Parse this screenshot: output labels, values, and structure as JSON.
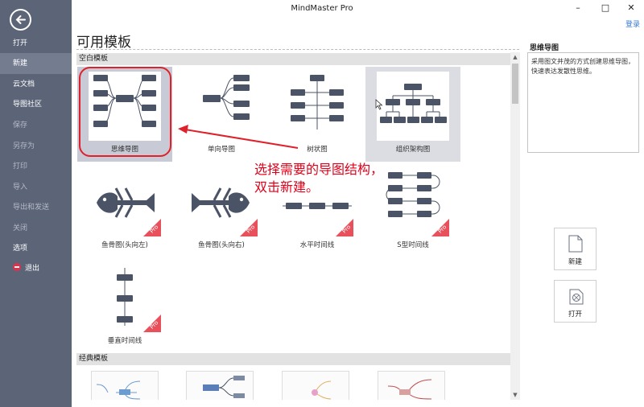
{
  "window": {
    "title": "MindMaster Pro",
    "minimize": "–",
    "maximize": "□",
    "close": "✕",
    "login": "登录"
  },
  "sidebar": {
    "items": [
      {
        "label": "打开"
      },
      {
        "label": "新建"
      },
      {
        "label": "云文档"
      },
      {
        "label": "导图社区"
      },
      {
        "label": "保存"
      },
      {
        "label": "另存为"
      },
      {
        "label": "打印"
      },
      {
        "label": "导入"
      },
      {
        "label": "导出和发送"
      },
      {
        "label": "关闭"
      },
      {
        "label": "选项"
      },
      {
        "label": "退出"
      }
    ]
  },
  "main": {
    "title": "可用模板",
    "section_blank": "空白模板",
    "section_classic": "经典模板",
    "templates": [
      {
        "label": "思维导图"
      },
      {
        "label": "单向导图"
      },
      {
        "label": "树状图"
      },
      {
        "label": "组织架构图"
      },
      {
        "label": "鱼骨图(头向左)"
      },
      {
        "label": "鱼骨图(头向右)"
      },
      {
        "label": "水平时间线"
      },
      {
        "label": "S型时间线"
      },
      {
        "label": "垂直时间线"
      }
    ],
    "pro_badge": "Pro"
  },
  "panel": {
    "title": "思维导图",
    "description": "采用图文并茂的方式创建思维导图，快速表达发散性思维。",
    "new_label": "新建",
    "open_label": "打开"
  },
  "annotation": {
    "text": "选择需要的导图结构，双击新建。"
  },
  "colors": {
    "sidebar": "#5c6578",
    "node": "#4b5466",
    "accent": "#e0202a",
    "badge": "#e8505b"
  }
}
